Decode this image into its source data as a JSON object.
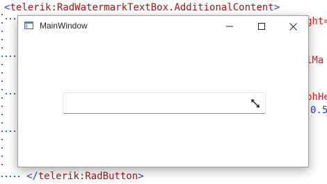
{
  "editor": {
    "top_line": {
      "open": "<",
      "name": "telerik:RadWatermarkTextBox.AdditionalContent",
      "close": ">"
    },
    "bottom_line": {
      "open": "</",
      "name": "telerik:RadButton",
      "close": ">"
    },
    "fragments": {
      "frag1": "ght=",
      "frag2": "lMa",
      "frag3": "phHe",
      "frag4": "0.5"
    }
  },
  "window": {
    "title": "MainWindow",
    "controls": {
      "minimize_icon": "minimize-icon",
      "maximize_icon": "maximize-icon",
      "close_icon": "close-icon"
    }
  },
  "textbox": {
    "value": "",
    "placeholder": "",
    "additional_content_icon": "resize-diagonal-arrow-icon"
  },
  "colors": {
    "tag_bracket": "#2f3bd0",
    "tag_name": "#a31515",
    "attribute": "#e21f1f",
    "number": "#2f3bd0",
    "dots": "#2f68c4"
  }
}
